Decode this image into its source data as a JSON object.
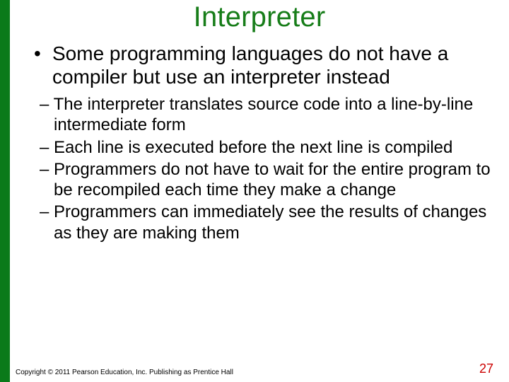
{
  "accent_stripe_color": "#0a7a1a",
  "title": "Interpreter",
  "bullets_level1": [
    "Some programming languages do not have a compiler but use an interpreter instead"
  ],
  "bullets_level2": [
    "The interpreter translates source code into a line-by-line intermediate form",
    "Each line is executed before the next line is compiled",
    "Programmers do not have to wait for the entire program to be recompiled each time they make a change",
    "Programmers can immediately see the results of changes as they are making them"
  ],
  "copyright": "Copyright © 2011 Pearson Education, Inc. Publishing as Prentice Hall",
  "page_number": "27"
}
